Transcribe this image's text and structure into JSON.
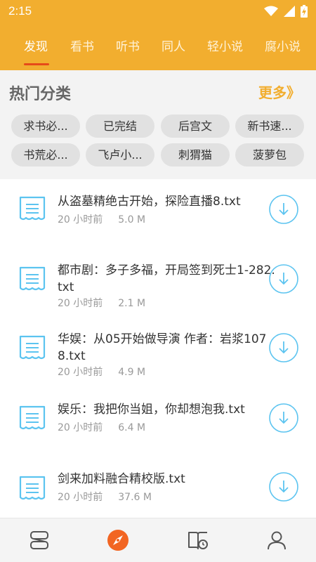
{
  "status_bar": {
    "time": "2:15"
  },
  "tabs": [
    {
      "label": "发现",
      "active": true
    },
    {
      "label": "看书"
    },
    {
      "label": "听书"
    },
    {
      "label": "同人"
    },
    {
      "label": "轻小说"
    },
    {
      "label": "腐小说"
    }
  ],
  "categories": {
    "title": "热门分类",
    "more_label": "更多》",
    "chips": [
      "求书必...",
      "已完结",
      "后宫文",
      "新书速...",
      "书荒必...",
      "飞卢小...",
      "刺猬猫",
      "菠萝包"
    ]
  },
  "files": [
    {
      "title": "从盗墓精绝古开始，探险直播8.txt",
      "time": "20 小时前",
      "size": "5.0 M"
    },
    {
      "title": "都市剧：多子多福，开局签到死士1-282.txt",
      "time": "20 小时前",
      "size": "2.1 M"
    },
    {
      "title": "华娱：从05开始做导演 作者：岩浆1078.txt",
      "time": "20 小时前",
      "size": "4.9 M"
    },
    {
      "title": "娱乐：我把你当姐，你却想泡我.txt",
      "time": "20 小时前",
      "size": "6.4 M"
    },
    {
      "title": "剑来加料融合精校版.txt",
      "time": "20 小时前",
      "size": "37.6 M"
    }
  ],
  "colors": {
    "accent": "#f2ae2f",
    "active_indicator": "#e64a19",
    "icon_blue": "#5cc4f0"
  },
  "bottom_nav": [
    {
      "icon": "bookshelf-icon"
    },
    {
      "icon": "compass-icon",
      "active": true
    },
    {
      "icon": "history-book-icon"
    },
    {
      "icon": "profile-icon"
    }
  ]
}
